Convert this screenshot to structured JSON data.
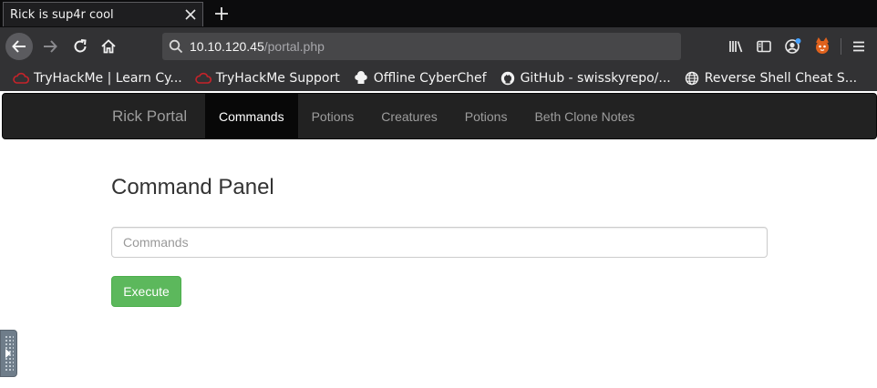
{
  "browser": {
    "tab": {
      "title": "Rick is sup4r cool"
    },
    "url": {
      "host": "10.10.120.45",
      "path": "/portal.php"
    },
    "bookmarks": [
      {
        "label": "TryHackMe | Learn Cy...",
        "icon": "tryhackme-icon"
      },
      {
        "label": "TryHackMe Support",
        "icon": "tryhackme-icon"
      },
      {
        "label": "Offline CyberChef",
        "icon": "chef-hat-icon"
      },
      {
        "label": "GitHub - swisskyrepo/...",
        "icon": "github-icon"
      },
      {
        "label": "Reverse Shell Cheat S...",
        "icon": "globe-icon"
      }
    ]
  },
  "page": {
    "brand": "Rick Portal",
    "nav": [
      {
        "label": "Commands",
        "active": true
      },
      {
        "label": "Potions"
      },
      {
        "label": "Creatures"
      },
      {
        "label": "Potions"
      },
      {
        "label": "Beth Clone Notes"
      }
    ],
    "title": "Command Panel",
    "input_placeholder": "Commands",
    "button_label": "Execute"
  },
  "colors": {
    "navbar_bg": "#222222",
    "active_nav_bg": "#080808",
    "button_green": "#5cb85c",
    "toolbar_bg": "#323234"
  }
}
